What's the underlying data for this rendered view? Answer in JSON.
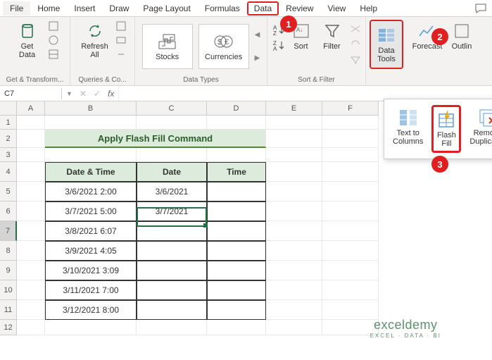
{
  "menu": {
    "file": "File",
    "home": "Home",
    "insert": "Insert",
    "draw": "Draw",
    "page_layout": "Page Layout",
    "formulas": "Formulas",
    "data": "Data",
    "review": "Review",
    "view": "View",
    "help": "Help"
  },
  "ribbon": {
    "get_data": "Get\nData",
    "refresh_all": "Refresh\nAll",
    "stocks": "Stocks",
    "currencies": "Currencies",
    "sort": "Sort",
    "filter": "Filter",
    "data_tools": "Data\nTools",
    "forecast": "Forecast",
    "outline": "Outlin",
    "groups": {
      "get_transform": "Get & Transform...",
      "queries": "Queries & Co...",
      "data_types": "Data Types",
      "sort_filter": "Sort & Filter"
    }
  },
  "popup": {
    "text_to_columns": "Text to\nColumns",
    "flash_fill": "Flash\nFill",
    "remove_duplicates": "Remove\nDuplicates"
  },
  "callouts": {
    "c1": "1",
    "c2": "2",
    "c3": "3"
  },
  "namebox": "C7",
  "fx_label": "fx",
  "col_headers": [
    "A",
    "B",
    "C",
    "D",
    "E",
    "F"
  ],
  "row_headers": [
    "1",
    "2",
    "3",
    "4",
    "5",
    "6",
    "7",
    "8",
    "9",
    "10",
    "11",
    "12"
  ],
  "banner": "Apply Flash Fill Command",
  "table": {
    "headers": [
      "Date & Time",
      "Date",
      "Time"
    ],
    "rows": [
      {
        "dt": "3/6/2021 2:00",
        "d": "3/6/2021",
        "t": ""
      },
      {
        "dt": "3/7/2021 5:00",
        "d": "3/7/2021",
        "t": ""
      },
      {
        "dt": "3/8/2021 6:07",
        "d": "",
        "t": ""
      },
      {
        "dt": "3/9/2021 4:05",
        "d": "",
        "t": ""
      },
      {
        "dt": "3/10/2021 3:09",
        "d": "",
        "t": ""
      },
      {
        "dt": "3/11/2021 7:00",
        "d": "",
        "t": ""
      },
      {
        "dt": "3/12/2021 8:00",
        "d": "",
        "t": ""
      }
    ]
  },
  "watermark": {
    "line1": "exceldemy",
    "line2": "EXCEL · DATA · BI"
  },
  "colors": {
    "accent": "#217346",
    "highlight": "#e02020",
    "banner_bg": "#ddebdc"
  }
}
